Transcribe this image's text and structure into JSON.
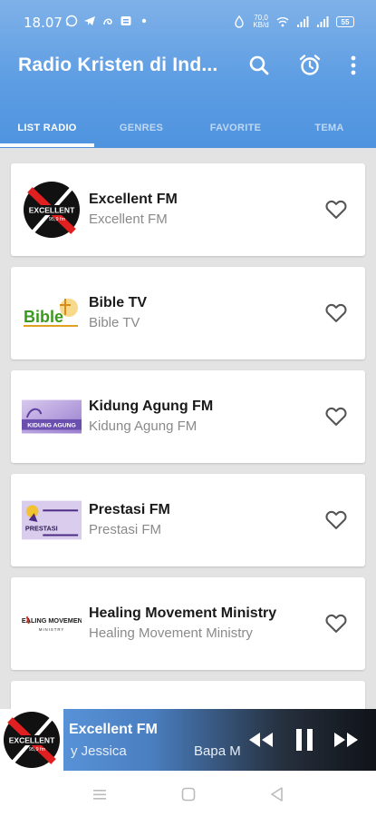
{
  "status_bar": {
    "time": "18.07",
    "network_speed": "70,0\nKB/d",
    "battery": "55"
  },
  "app_bar": {
    "title": "Radio Kristen di Ind...",
    "actions": [
      {
        "name": "search-icon"
      },
      {
        "name": "alarm-icon"
      },
      {
        "name": "more-vert-icon"
      }
    ]
  },
  "tabs": [
    {
      "label": "LIST RADIO",
      "active": true
    },
    {
      "label": "GENRES",
      "active": false
    },
    {
      "label": "FAVORITE",
      "active": false
    },
    {
      "label": "TEMA",
      "active": false
    }
  ],
  "stations": [
    {
      "name": "Excellent FM",
      "subtitle": "Excellent FM",
      "logo_text": "EXCELLENT",
      "logo_sub": "95,9 fm"
    },
    {
      "name": "Bible TV",
      "subtitle": "Bible TV",
      "logo_text": "Bible"
    },
    {
      "name": "Kidung Agung FM",
      "subtitle": "Kidung Agung FM",
      "logo_text": "KIDUNG AGUNG"
    },
    {
      "name": "Prestasi FM",
      "subtitle": "Prestasi FM",
      "logo_text": "PRESTASI"
    },
    {
      "name": "Healing Movement Ministry",
      "subtitle": "Healing Movement Ministry",
      "logo_text": "HEALING MOVEMENT",
      "logo_sub": "MINISTRY"
    }
  ],
  "player": {
    "title": "Excellent FM",
    "meta_left": "y Jessica",
    "meta_right": "Bapa M",
    "logo_text": "EXCELLENT",
    "logo_sub": "95,9 fm"
  },
  "colors": {
    "app_bar": "#5d9de3",
    "card": "#ffffff",
    "background": "#e3e3e3"
  }
}
